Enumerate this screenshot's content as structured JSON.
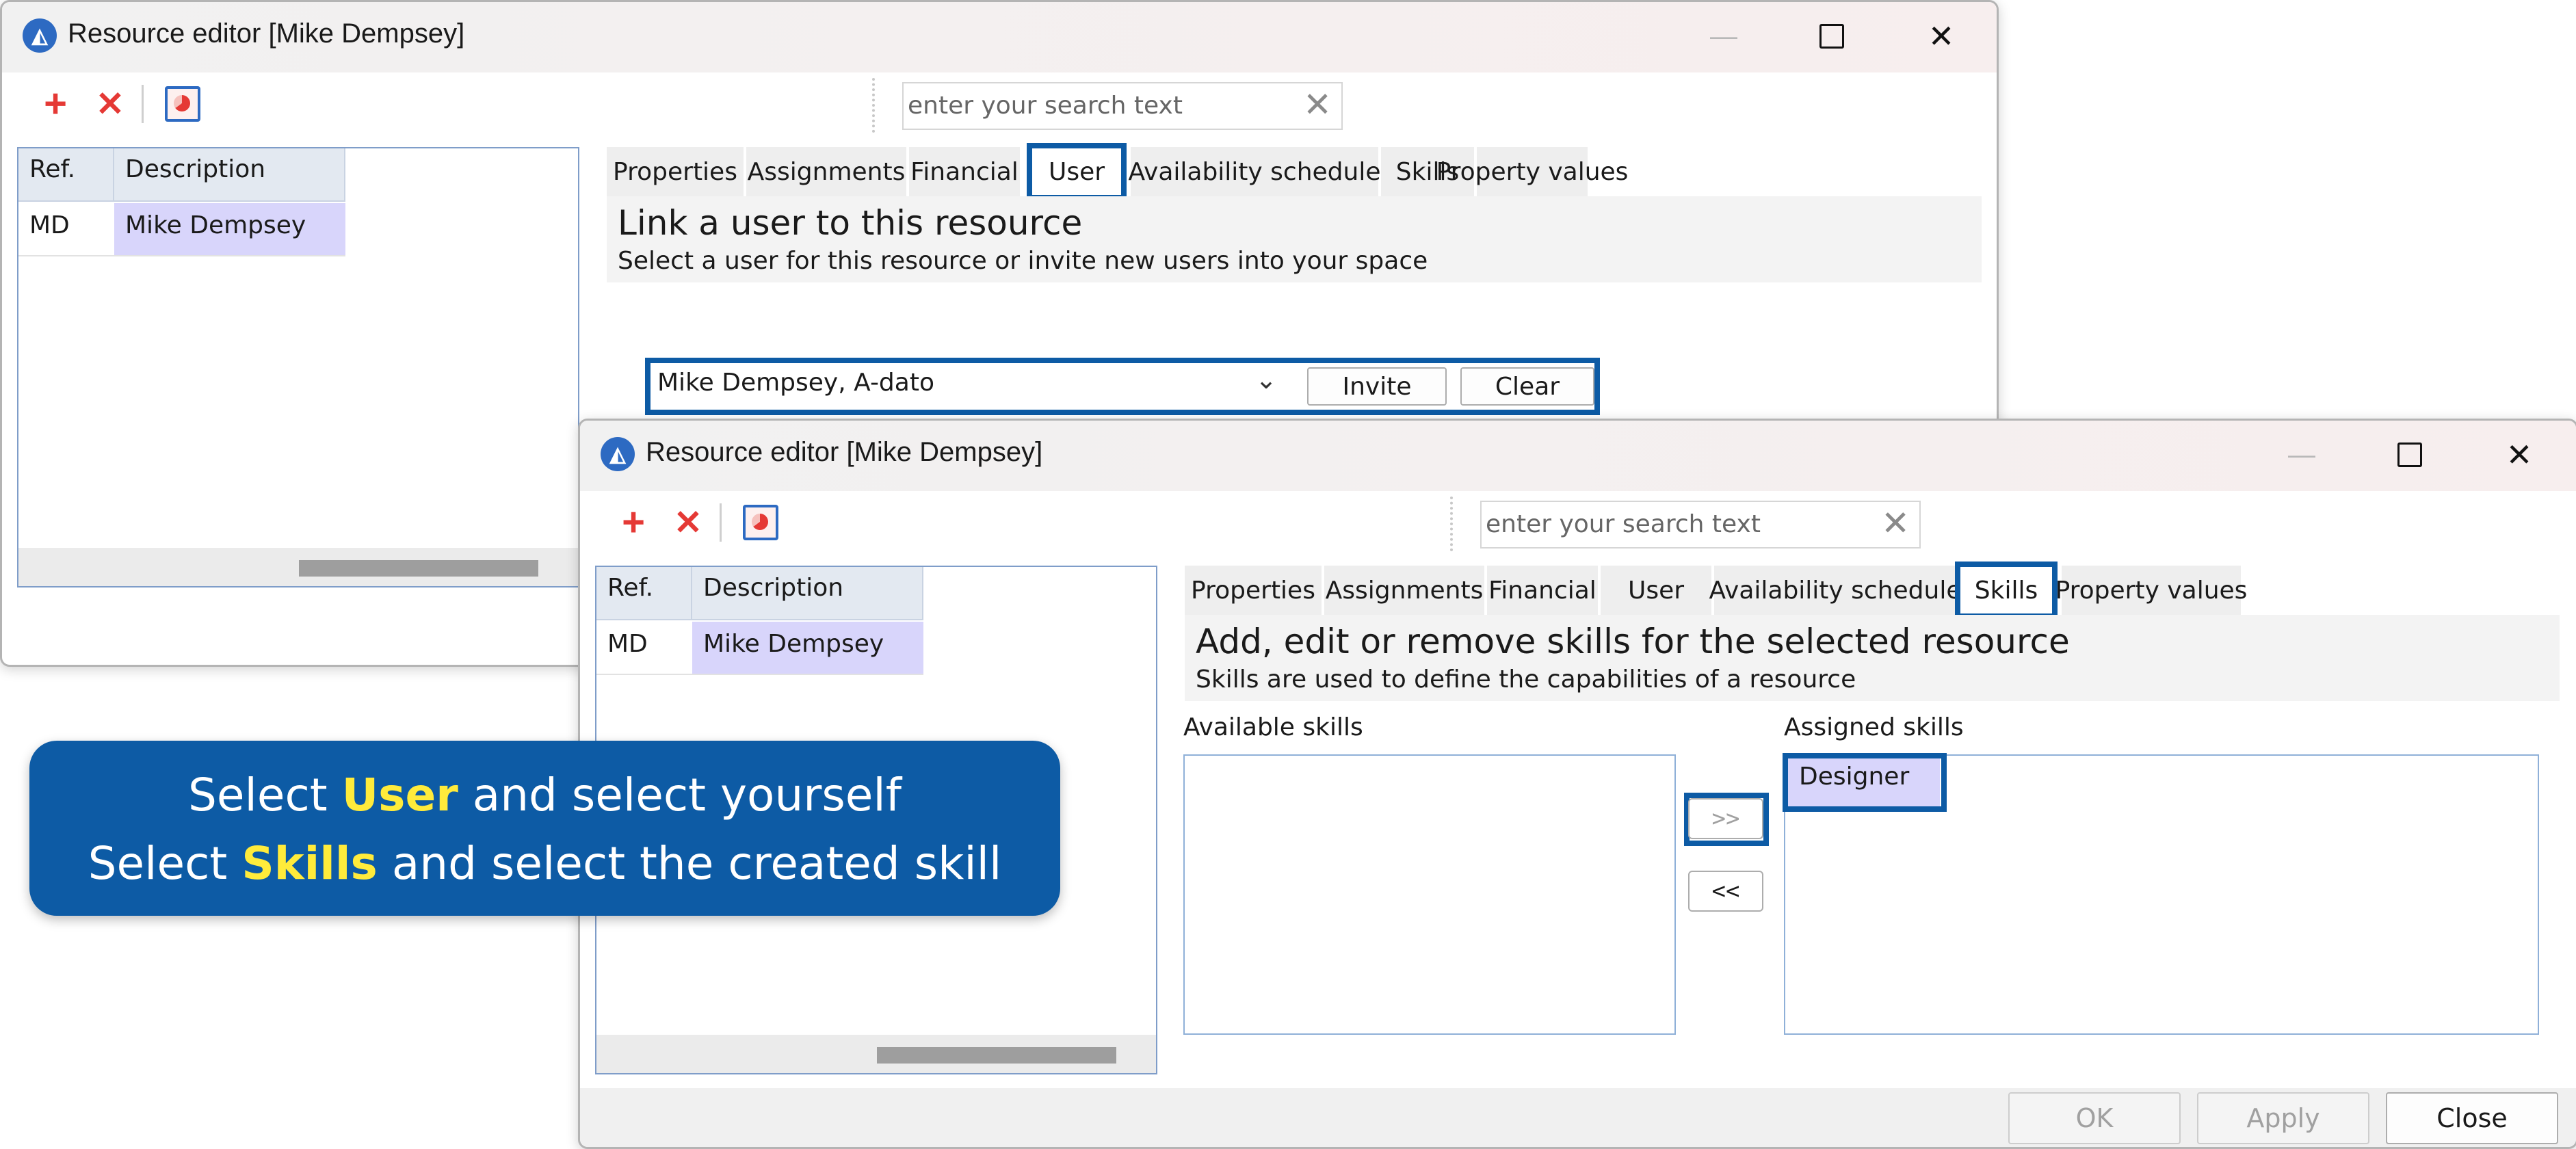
{
  "window1": {
    "title": "Resource editor [Mike Dempsey]",
    "search": {
      "placeholder": "enter your search text"
    },
    "grid": {
      "columns": [
        "Ref.",
        "Description"
      ],
      "rows": [
        {
          "ref": "MD",
          "description": "Mike Dempsey"
        }
      ]
    },
    "tabs": [
      "Properties",
      "Assignments",
      "Financial",
      "User",
      "Availability schedule",
      "Skills",
      "Property values"
    ],
    "active_tab": "User",
    "header": {
      "title": "Link a user to this resource",
      "subtitle": "Select a user for this resource or invite new users into your space"
    },
    "user_select": {
      "value": "Mike Dempsey, A-dato"
    },
    "invite_label": "Invite",
    "clear_label": "Clear"
  },
  "window2": {
    "title": "Resource editor [Mike Dempsey]",
    "search": {
      "placeholder": "enter your search text"
    },
    "grid": {
      "columns": [
        "Ref.",
        "Description"
      ],
      "rows": [
        {
          "ref": "MD",
          "description": "Mike Dempsey"
        }
      ]
    },
    "tabs": [
      "Properties",
      "Assignments",
      "Financial",
      "User",
      "Availability schedule",
      "Skills",
      "Property values"
    ],
    "active_tab": "Skills",
    "header": {
      "title": "Add, edit or remove skills for the selected resource",
      "subtitle": "Skills are used to define the capabilities of a resource"
    },
    "available_label": "Available skills",
    "assigned_label": "Assigned skills",
    "available_skills": [],
    "assigned_skills": [
      "Designer"
    ],
    "move_right_label": ">>",
    "move_left_label": "<<",
    "footer": {
      "ok": "OK",
      "apply": "Apply",
      "close": "Close"
    }
  },
  "callout": {
    "line1": {
      "pre": "Select ",
      "keyword": "User",
      "post": " and select yourself"
    },
    "line2": {
      "pre": "Select ",
      "keyword": "Skills",
      "post": " and select the created skill"
    }
  },
  "colors": {
    "accent": "#0d5ba5",
    "highlight_text": "#ffeb3b",
    "selection": "#d8d5fb",
    "delete_red": "#e53935"
  },
  "icons": {
    "app": "a-dato-logo-icon",
    "add": "plus-icon",
    "delete": "x-icon",
    "report": "chart-icon",
    "clear_search": "close-icon",
    "dropdown": "chevron-down-icon"
  }
}
